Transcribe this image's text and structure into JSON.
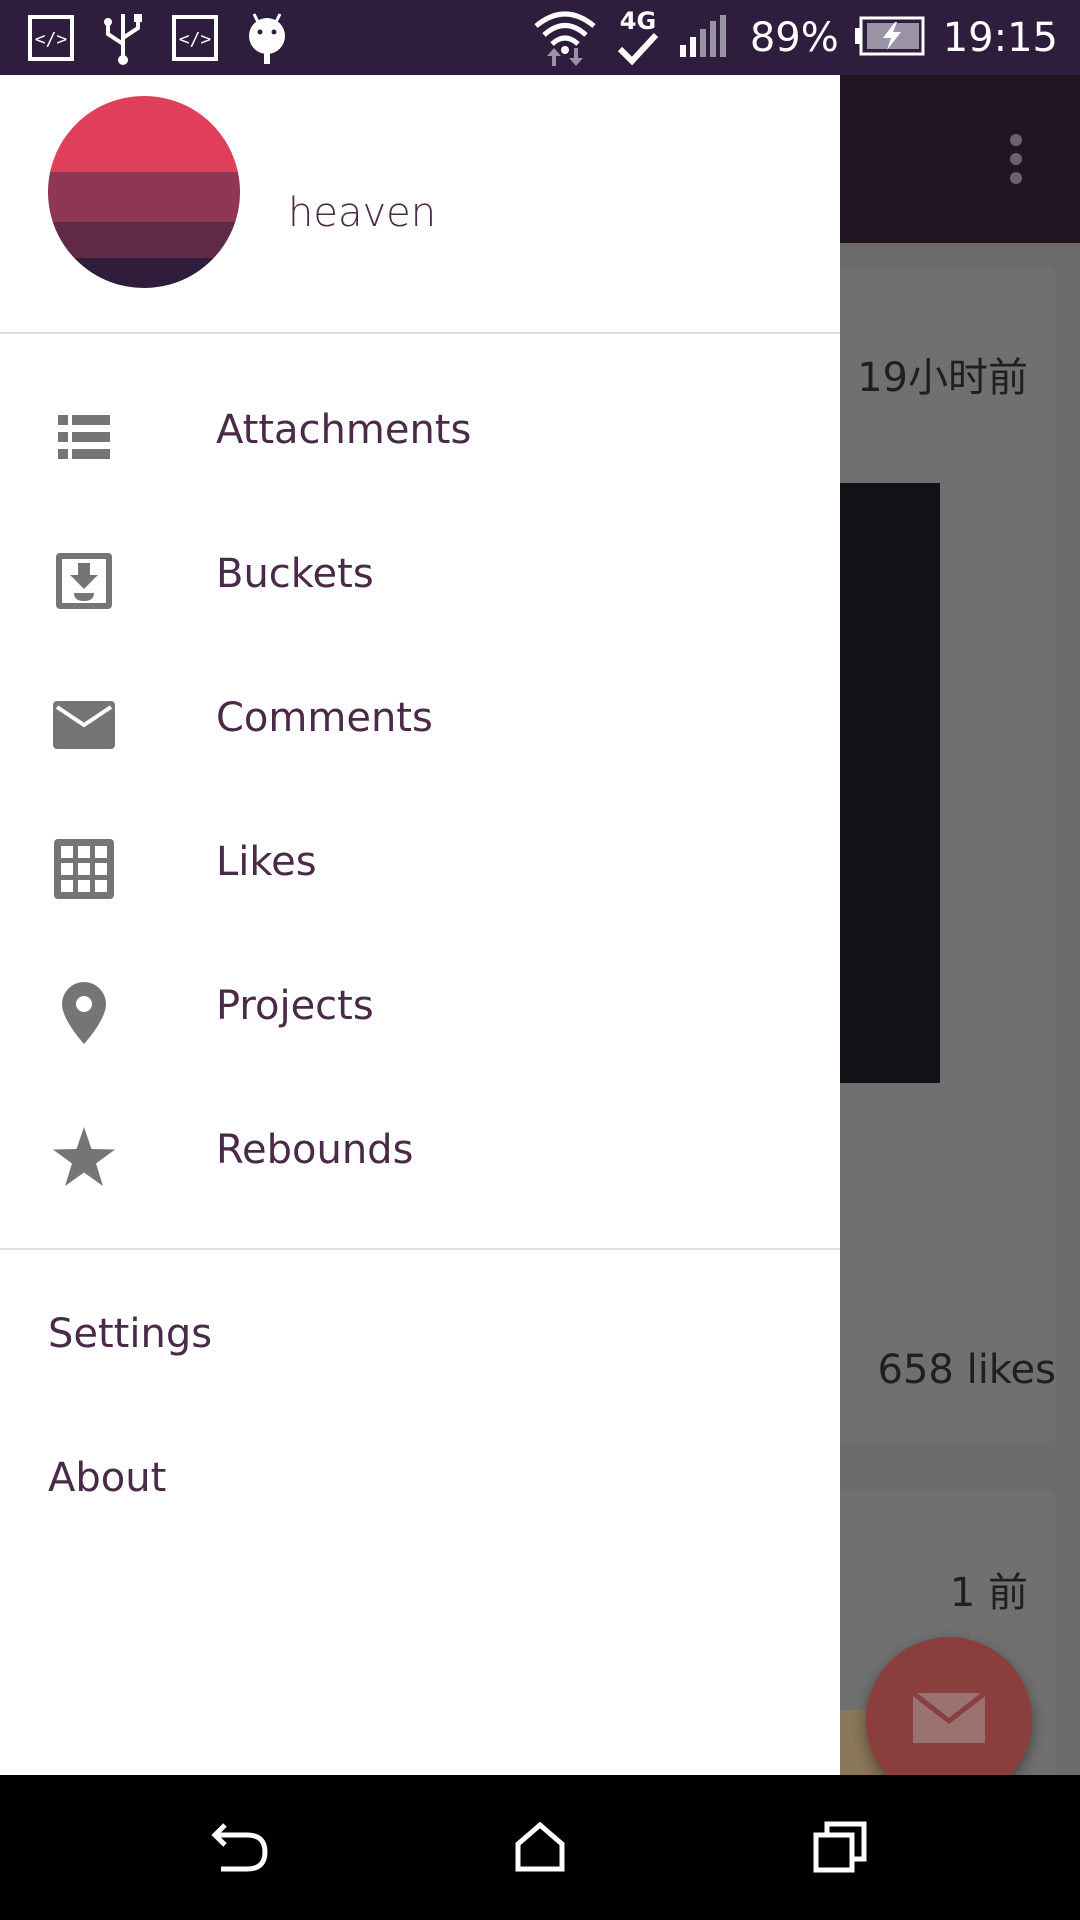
{
  "status_bar": {
    "battery": "89%",
    "time": "19:15",
    "network": "4G",
    "icons_left": [
      "code-icon",
      "usb-icon",
      "code-icon",
      "android-debug-icon"
    ],
    "icons_right": [
      "wifi-icon",
      "4g-icon",
      "signal-icon",
      "battery-charging-icon"
    ]
  },
  "drawer": {
    "username": "heaven",
    "nav_items": [
      {
        "label": "Attachments",
        "icon": "list-icon"
      },
      {
        "label": "Buckets",
        "icon": "inbox-download-icon"
      },
      {
        "label": "Comments",
        "icon": "mail-icon"
      },
      {
        "label": "Likes",
        "icon": "grid-icon"
      },
      {
        "label": "Projects",
        "icon": "location-pin-icon"
      },
      {
        "label": "Rebounds",
        "icon": "star-icon"
      }
    ],
    "secondary_items": [
      {
        "label": "Settings"
      },
      {
        "label": "About"
      }
    ]
  },
  "background": {
    "card1_time": "19小时前",
    "card1_likes": "658 likes",
    "card2_time": "1 前"
  },
  "colors": {
    "status_bar": "#2e1d3c",
    "toolbar": "#221420",
    "text": "#4a2a48",
    "icon": "#757575",
    "fab": "#8a3e3e"
  }
}
